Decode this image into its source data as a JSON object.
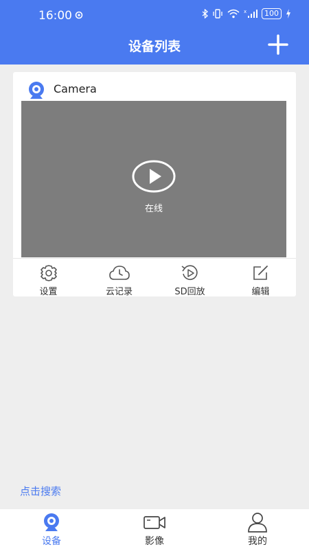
{
  "status_bar": {
    "time": "16:00",
    "battery": "100"
  },
  "header": {
    "title": "设备列表"
  },
  "device": {
    "name": "Camera",
    "state": "在线",
    "actions": [
      {
        "label": "设置",
        "icon": "gear-icon"
      },
      {
        "label": "云记录",
        "icon": "cloud-clock-icon"
      },
      {
        "label": "SD回放",
        "icon": "replay-icon"
      },
      {
        "label": "编辑",
        "icon": "edit-icon"
      }
    ]
  },
  "search_link": "点击搜索",
  "tabs": [
    {
      "label": "设备",
      "icon": "camera-icon",
      "active": true
    },
    {
      "label": "影像",
      "icon": "video-icon",
      "active": false
    },
    {
      "label": "我的",
      "icon": "user-icon",
      "active": false
    }
  ],
  "colors": {
    "primary": "#4a7af0",
    "video_bg": "#7d7d7d",
    "page_bg": "#eeeeee"
  }
}
